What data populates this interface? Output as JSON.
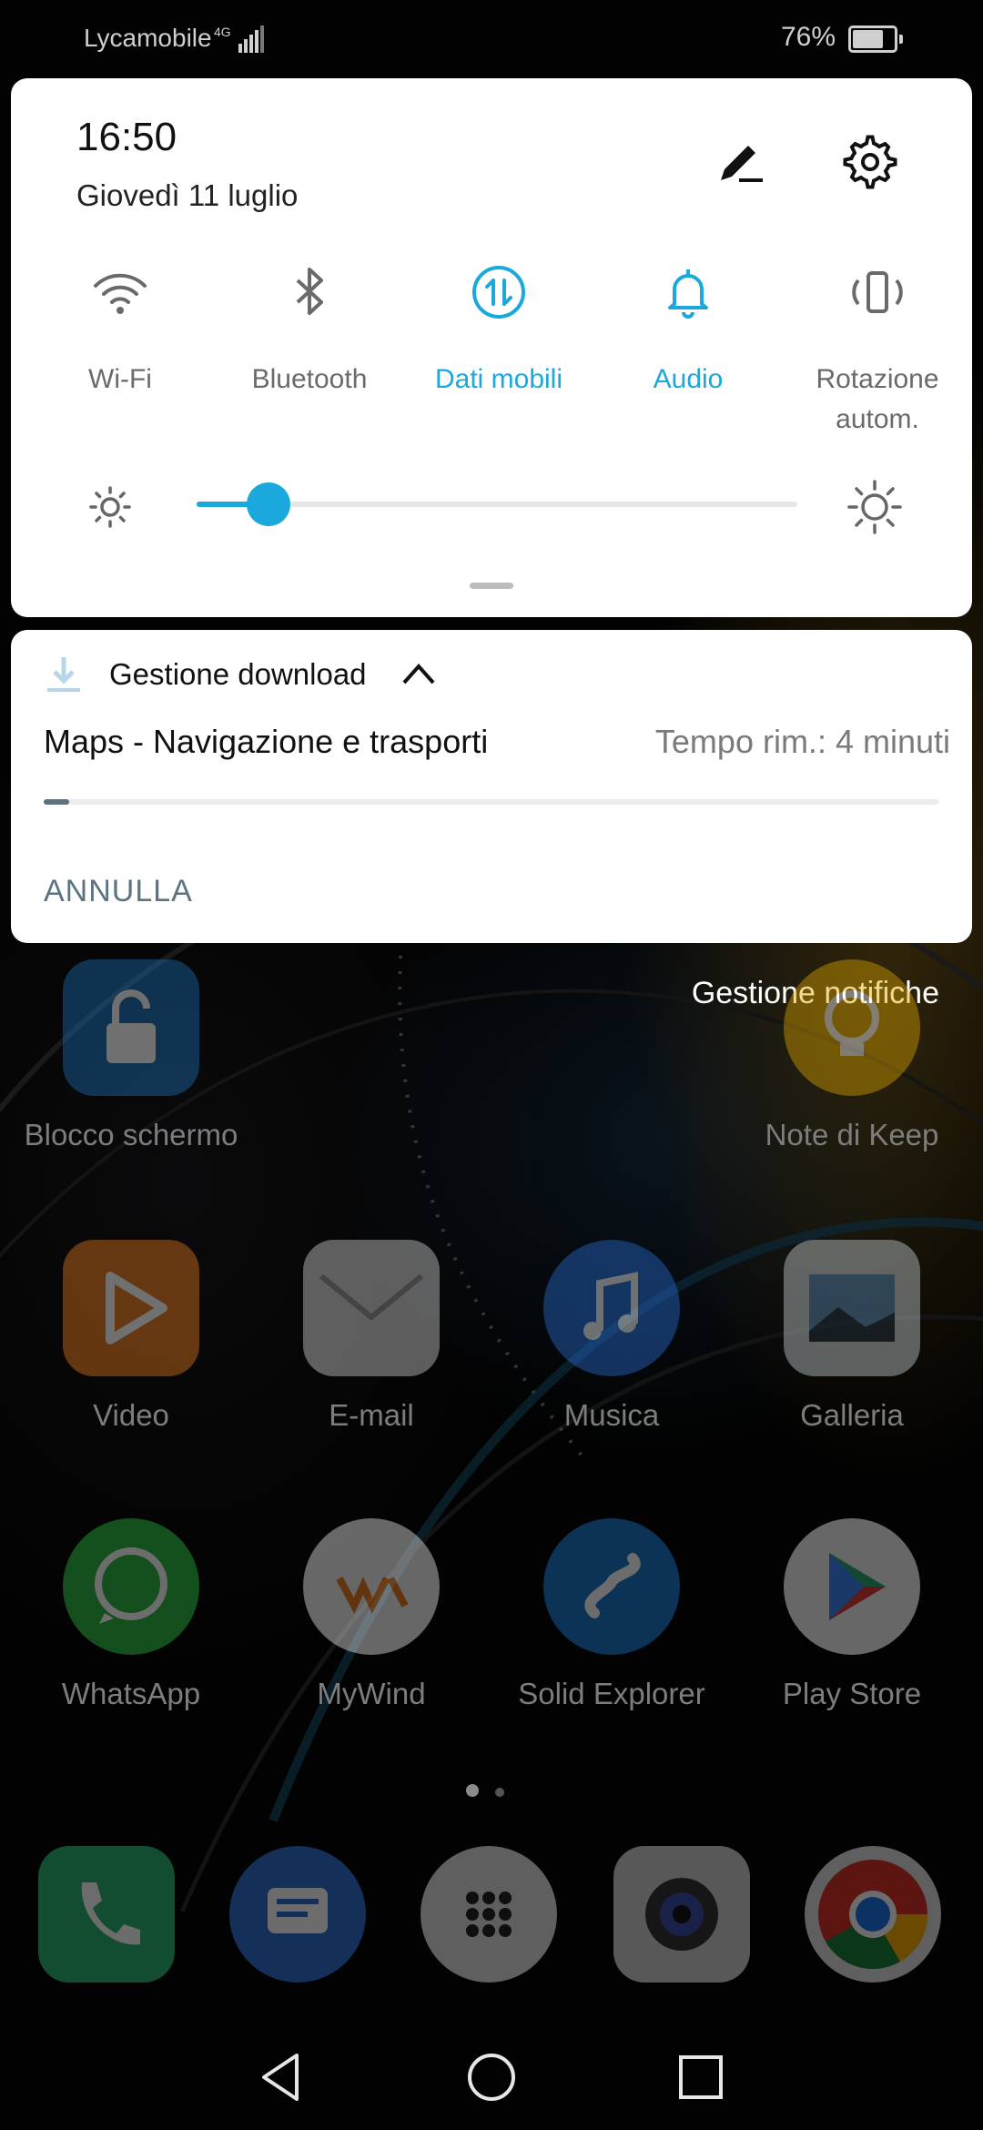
{
  "status_bar": {
    "carrier": "Lycamobile",
    "network": "4G",
    "battery_percent": "76%",
    "battery_level": 0.76
  },
  "quick_settings": {
    "time": "16:50",
    "date": "Giovedì 11 luglio",
    "tiles": [
      {
        "label": "Wi-Fi",
        "icon": "wifi-icon",
        "active": false
      },
      {
        "label": "Bluetooth",
        "icon": "bluetooth-icon",
        "active": false
      },
      {
        "label": "Dati mobili",
        "icon": "mobile-data-icon",
        "active": true
      },
      {
        "label": "Audio",
        "icon": "bell-icon",
        "active": true
      },
      {
        "label": "Rotazione autom.",
        "icon": "auto-rotate-icon",
        "active": false
      }
    ],
    "brightness_level": 0.12,
    "accent_color": "#1ba8dc"
  },
  "notification": {
    "app_name": "Gestione download",
    "title": "Maps - Navigazione e trasporti",
    "time_remaining": "Tempo rim.: 4 minuti",
    "progress": 0.02,
    "action": "ANNULLA"
  },
  "manage_notifications": "Gestione notifiche",
  "home": {
    "apps": [
      {
        "name": "Blocco schermo",
        "color": "#1a6fb5"
      },
      {
        "name": "Note di Keep",
        "color": "#e0a800"
      },
      {
        "name": "Video",
        "color": "#e57a1e"
      },
      {
        "name": "E-mail",
        "color": "#d9d9d9"
      },
      {
        "name": "Musica",
        "color": "#2a6fd6"
      },
      {
        "name": "Galleria",
        "color": "#cfd8dc"
      },
      {
        "name": "WhatsApp",
        "color": "#2cb742"
      },
      {
        "name": "MyWind",
        "color": "#f2f2f2"
      },
      {
        "name": "Solid Explorer",
        "color": "#1c78c8"
      },
      {
        "name": "Play Store",
        "color": "#f2f2f2"
      }
    ],
    "dock": [
      {
        "name": "phone",
        "color": "#2bb673"
      },
      {
        "name": "messages",
        "color": "#2f6fd0"
      },
      {
        "name": "app-drawer",
        "color": "#e0e0e0"
      },
      {
        "name": "camera",
        "color": "#cfcfcf"
      },
      {
        "name": "chrome",
        "color": "#e0e0e0"
      }
    ]
  }
}
